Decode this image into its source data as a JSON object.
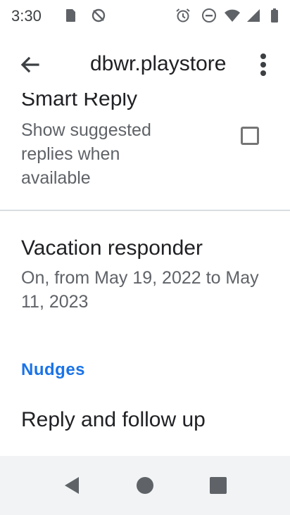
{
  "status_bar": {
    "time": "3:30",
    "left_icons": [
      "sd-card-icon",
      "no-sync-icon"
    ],
    "right_icons": [
      "alarm-icon",
      "do-not-disturb-icon",
      "wifi-icon",
      "cell-signal-icon",
      "battery-icon"
    ]
  },
  "app_bar": {
    "title": "dbwr.playstore",
    "back_icon": "arrow-back-icon",
    "overflow_icon": "more-vert-icon"
  },
  "settings": {
    "smart_reply": {
      "title": "Smart Reply",
      "description": "Show suggested replies when available",
      "checked": false
    },
    "vacation_responder": {
      "title": "Vacation responder",
      "status": "On, from May 19, 2022 to May 11, 2023"
    },
    "nudges": {
      "header": "Nudges",
      "items": [
        {
          "title": "Reply and follow up"
        }
      ]
    }
  },
  "nav_bar": {
    "buttons": [
      "back-triangle-icon",
      "home-circle-icon",
      "recents-square-icon"
    ]
  },
  "colors": {
    "accent": "#1a73e8",
    "text_primary": "#202124",
    "text_secondary": "#5f6368",
    "nav_bar": "#f1f3f4"
  }
}
